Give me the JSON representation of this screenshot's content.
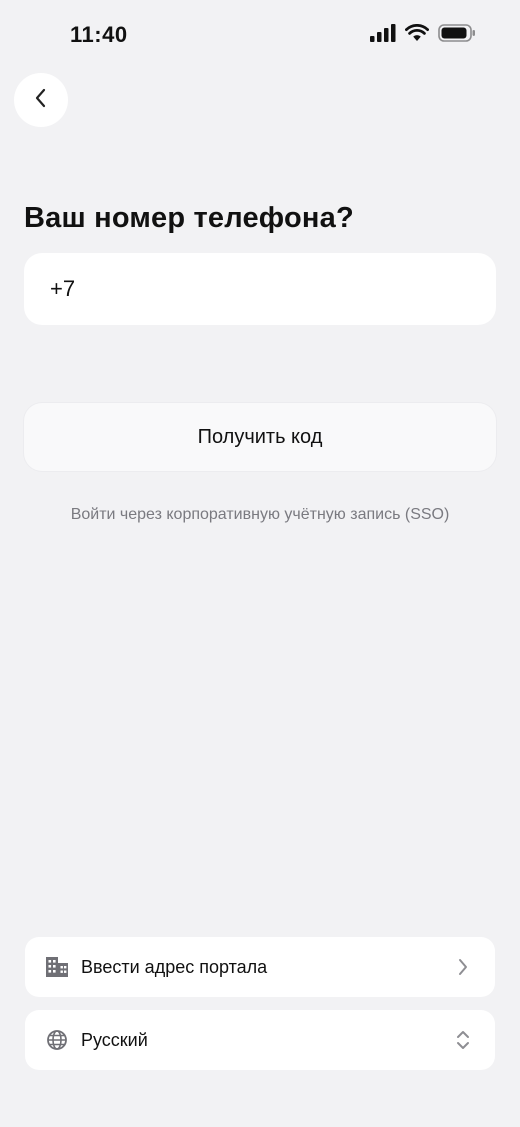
{
  "status_bar": {
    "time": "11:40",
    "icons": [
      "cellular-signal-icon",
      "wifi-icon",
      "battery-icon"
    ]
  },
  "header": {
    "back_icon": "chevron-left-icon"
  },
  "main": {
    "title": "Ваш номер телефона?",
    "phone_input": {
      "value": "+7"
    },
    "get_code_label": "Получить код",
    "sso_link_label": "Войти через корпоративную учётную запись (SSO)"
  },
  "bottom": {
    "portal": {
      "label": "Ввести адрес портала",
      "icon": "building-icon",
      "trailing_icon": "chevron-right-icon"
    },
    "language": {
      "label": "Русский",
      "icon": "globe-icon",
      "trailing_icon": "chevron-up-down-icon"
    }
  },
  "colors": {
    "background": "#f2f2f4",
    "surface": "#ffffff",
    "text_primary": "#111111",
    "text_secondary": "#7a7a80"
  }
}
